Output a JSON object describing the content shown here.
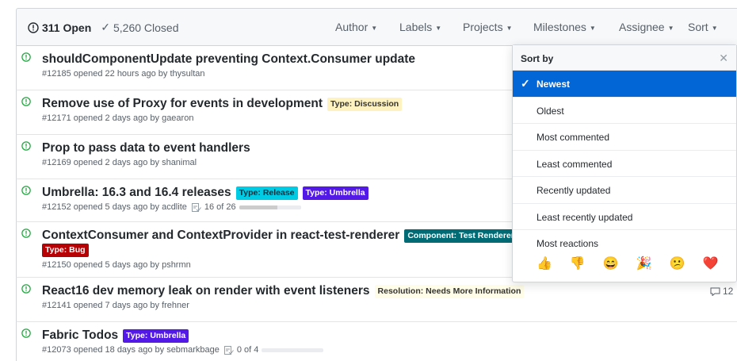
{
  "header": {
    "open_label": "311 Open",
    "closed_label": "5,260 Closed",
    "filters": [
      {
        "label": "Author",
        "name": "filter-author"
      },
      {
        "label": "Labels",
        "name": "filter-labels"
      },
      {
        "label": "Projects",
        "name": "filter-projects"
      },
      {
        "label": "Milestones",
        "name": "filter-milestones"
      },
      {
        "label": "Assignee",
        "name": "filter-assignee"
      },
      {
        "label": "Sort",
        "name": "filter-sort"
      }
    ]
  },
  "issues": [
    {
      "title": "shouldComponentUpdate preventing Context.Consumer update",
      "meta": "#12185 opened 22 hours ago by thysultan",
      "labels": []
    },
    {
      "title": "Remove use of Proxy for events in development",
      "meta": "#12171 opened 2 days ago by gaearon",
      "labels": [
        {
          "text": "Type: Discussion",
          "bg": "#fef2c0",
          "fg": "#333333"
        }
      ]
    },
    {
      "title": "Prop to pass data to event handlers",
      "meta": "#12169 opened 2 days ago by shanimal",
      "labels": []
    },
    {
      "title": "Umbrella: 16.3 and 16.4 releases",
      "meta": "#12152 opened 5 days ago by acdlite",
      "progress": "16 of 26",
      "progress_fraction": 0.615,
      "labels": [
        {
          "text": "Type: Release",
          "bg": "#00cbe5",
          "fg": "#0b2e3a"
        },
        {
          "text": "Type: Umbrella",
          "bg": "#5319e7",
          "fg": "#ffffff"
        }
      ]
    },
    {
      "title": "ContextConsumer and ContextProvider in react-test-renderer",
      "meta": "#12150 opened 5 days ago by pshrmn",
      "labels": [
        {
          "text": "Component: Test Renderer",
          "bg": "#006b75",
          "fg": "#ffffff"
        }
      ],
      "labels_line2": [
        {
          "text": "Type: Bug",
          "bg": "#b60205",
          "fg": "#ffffff"
        }
      ]
    },
    {
      "title": "React16 dev memory leak on render with event listeners",
      "meta": "#12141 opened 7 days ago by frehner",
      "comments": "12",
      "labels": [
        {
          "text": "Resolution: Needs More Information",
          "bg": "#fffde7",
          "fg": "#333333"
        }
      ]
    },
    {
      "title": "Fabric Todos",
      "meta": "#12073 opened 18 days ago by sebmarkbage",
      "progress": "0 of 4",
      "progress_fraction": 0,
      "labels": [
        {
          "text": "Type: Umbrella",
          "bg": "#5319e7",
          "fg": "#ffffff"
        }
      ]
    }
  ],
  "sort_menu": {
    "title": "Sort by",
    "items": [
      "Newest",
      "Oldest",
      "Most commented",
      "Least commented",
      "Recently updated",
      "Least recently updated",
      "Most reactions"
    ],
    "selected_index": 0,
    "reactions": [
      "👍",
      "👎",
      "😄",
      "🎉",
      "😕",
      "❤️"
    ]
  },
  "colors": {
    "open_icon": "#28a745",
    "selected_bg": "#0366d6"
  }
}
